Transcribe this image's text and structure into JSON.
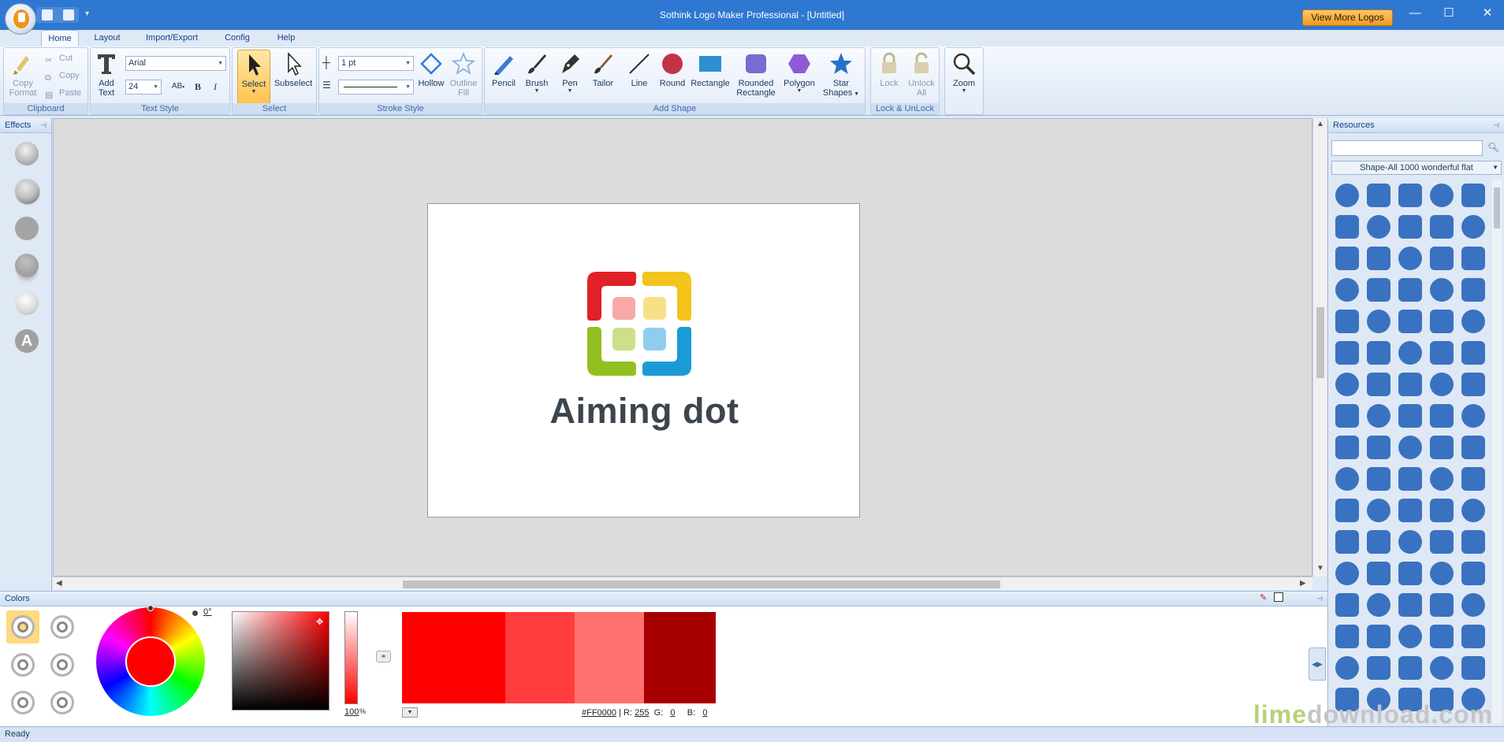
{
  "window": {
    "title": "Sothink Logo Maker Professional - [Untitled]",
    "view_more": "View More Logos",
    "minimize": "—",
    "maximize": "☐",
    "close": "✕"
  },
  "ribbon_tabs": [
    "Home",
    "Layout",
    "Import/Export",
    "Config",
    "Help"
  ],
  "ribbon": {
    "clipboard": {
      "label": "Clipboard",
      "copy_format": "Copy",
      "copy_format_2": "Format",
      "cut": "Cut",
      "copy": "Copy",
      "paste": "Paste"
    },
    "text_style": {
      "label": "Text Style",
      "add_text": "Add",
      "add_text_2": "Text",
      "font": "Arial",
      "size": "24",
      "bold": "B",
      "italic": "I",
      "spacing": "AB"
    },
    "select": {
      "label": "Select",
      "select": "Select",
      "subselect": "Subselect"
    },
    "stroke_style": {
      "label": "Stroke Style",
      "width": "1 pt",
      "hollow": "Hollow",
      "outline": "Outline",
      "outline_2": "Fill"
    },
    "add_shape": {
      "label": "Add Shape",
      "pencil": "Pencil",
      "brush": "Brush",
      "pen": "Pen",
      "tailor": "Tailor",
      "line": "Line",
      "round": "Round",
      "rectangle": "Rectangle",
      "rounded": "Rounded",
      "rounded_2": "Rectangle",
      "polygon": "Polygon",
      "star": "Star",
      "star_2": "Shapes"
    },
    "lock": {
      "label": "Lock & UnLock",
      "lock": "Lock",
      "unlock": "Unlock",
      "unlock_2": "All"
    },
    "zoom": {
      "label": "Zoom"
    }
  },
  "effects": {
    "title": "Effects",
    "items": [
      "glossy",
      "bevel",
      "flat",
      "shadow",
      "light",
      "text-a"
    ]
  },
  "canvas": {
    "logo_text": "Aiming dot",
    "colors": {
      "red": "#e02127",
      "yellow": "#f2c41c",
      "green": "#93c021",
      "blue": "#1b9ad8",
      "pink": "#f8a9a9",
      "pale_yellow": "#f8e089",
      "pale_green": "#cbe089",
      "pale_blue": "#8fcdee",
      "text": "#3c454e"
    }
  },
  "resources": {
    "title": "Resources",
    "search_placeholder": "",
    "category": "Shape-All 1000 wonderful flat",
    "icon_color": "#3a72c2",
    "icons": [
      "film-icon",
      "ship-icon",
      "bus-icon",
      "handshake-icon",
      "dog-icon",
      "hand-icon",
      "fish-icon",
      "snowman-icon",
      "cloud-icon",
      "car-icon",
      "flower-icon",
      "truck-icon",
      "plane-icon",
      "target-icon",
      "chart-icon",
      "cup-icon",
      "gift-icon",
      "stack-icon",
      "mail-icon",
      "pencil-icon",
      "lock-icon",
      "horn-icon",
      "compass-icon",
      "masks-icon",
      "house-icon",
      "coffee-icon",
      "saturn-icon",
      "star-burst-icon",
      "globe-icon",
      "globe-icon",
      "globe-icon",
      "globe-icon",
      "globe-icon",
      "globe-icon",
      "drops-icon",
      "cloud-icon",
      "monitor-icon",
      "camera-icon",
      "globe-icon",
      "globe-icon",
      "globe-icon",
      "speech-icon",
      "speech-icon",
      "eye-icon",
      "refresh-icon",
      "globe-icon",
      "pin-globe-icon",
      "hand-icon",
      "thumbs-up-icon",
      "hand-point-icon",
      "thumbs-down-icon",
      "hand-icon",
      "hand-point-icon",
      "hand-point-icon",
      "hand-stop-icon",
      "thumbs-up-icon",
      "globe-icon",
      "globe-icon",
      "card-icon",
      "pin-icon",
      "at-icon",
      "music-icon",
      "guitar-icon",
      "plane-icon",
      "news-icon",
      "phone-icon",
      "eye-icon",
      "news-icon",
      "globe-icon",
      "globe-icon",
      "globe-icon",
      "cup-icon",
      "hand-icon",
      "microphone-icon",
      "folder-icon",
      "clapper-icon",
      "grid-icon",
      "wall-icon",
      "plug-icon",
      "gear-icon",
      "eye-icon",
      "wheel-icon",
      "bird-icon",
      "ball-icon",
      "puzzle-icon"
    ]
  },
  "colors_panel": {
    "title": "Colors",
    "angle": "0°",
    "alpha": "100",
    "alpha_unit": "%",
    "hex": "#FF0000",
    "r_label": "R:",
    "r": "255",
    "g_label": "G:",
    "g": "0",
    "b_label": "B:",
    "b": "0",
    "current_color": "#ff0000",
    "swatches": [
      "#ff0000",
      "#ff3d3d",
      "#ff7070",
      "#a80000"
    ]
  },
  "status": {
    "text": "Ready"
  },
  "watermark": {
    "part1": "lime",
    "part2": "download.com"
  }
}
